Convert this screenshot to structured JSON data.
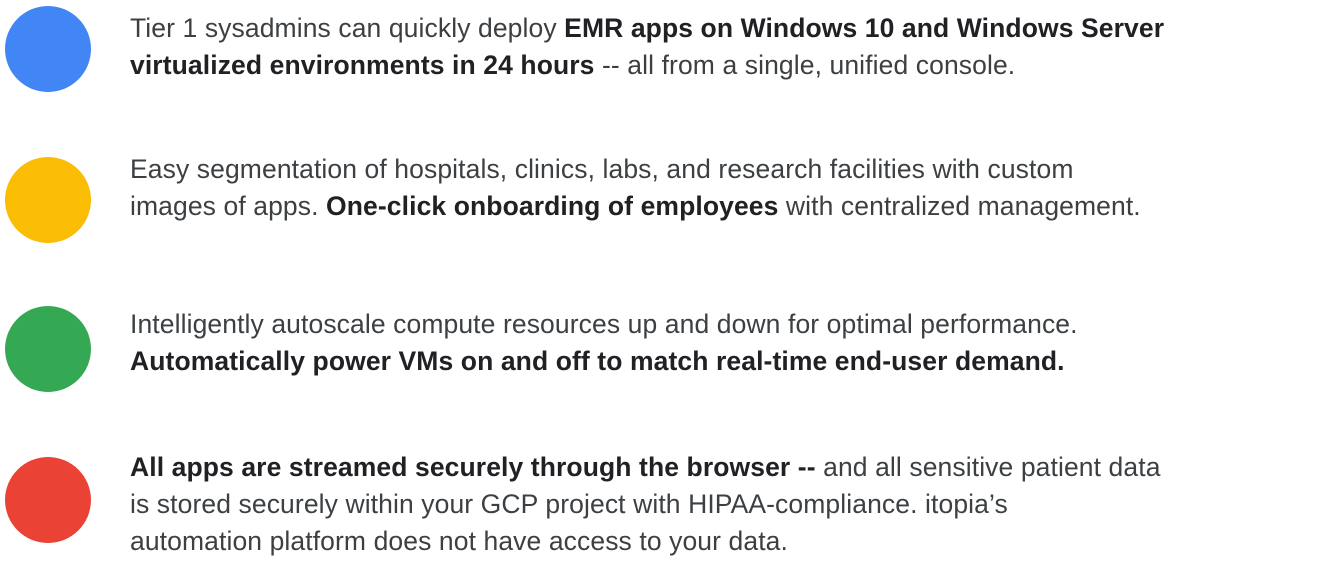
{
  "colors": {
    "blue": "#4285f4",
    "yellow": "#fbbc04",
    "green": "#34a853",
    "red": "#ea4335",
    "text": "#3c4043"
  },
  "items": [
    {
      "color_name": "blue",
      "lines": [
        [
          {
            "text": "Tier 1 sysadmins can quickly deploy ",
            "bold": false
          },
          {
            "text": "EMR apps on Windows 10 and Windows Server",
            "bold": true
          }
        ],
        [
          {
            "text": "virtualized environments in 24 hours",
            "bold": true
          },
          {
            "text": " -- all from a single, unified console.",
            "bold": false
          }
        ]
      ]
    },
    {
      "color_name": "yellow",
      "lines": [
        [
          {
            "text": "Easy segmentation of hospitals, clinics, labs, and research facilities with custom",
            "bold": false
          }
        ],
        [
          {
            "text": "images of apps. ",
            "bold": false
          },
          {
            "text": "One-click onboarding of employees",
            "bold": true
          },
          {
            "text": " with centralized management.",
            "bold": false
          }
        ]
      ]
    },
    {
      "color_name": "green",
      "lines": [
        [
          {
            "text": "Intelligently autoscale compute resources up and down for optimal performance.",
            "bold": false
          }
        ],
        [
          {
            "text": "Automatically power VMs on and off to match real-time end-user demand.",
            "bold": true
          }
        ]
      ]
    },
    {
      "color_name": "red",
      "lines": [
        [
          {
            "text": "All apps are streamed securely through the browser --",
            "bold": true
          },
          {
            "text": " and all sensitive patient data",
            "bold": false
          }
        ],
        [
          {
            "text": "is stored securely within your GCP project with HIPAA-compliance. itopia’s",
            "bold": false
          }
        ],
        [
          {
            "text": "automation platform does not have access to your data.",
            "bold": false
          }
        ]
      ]
    }
  ]
}
